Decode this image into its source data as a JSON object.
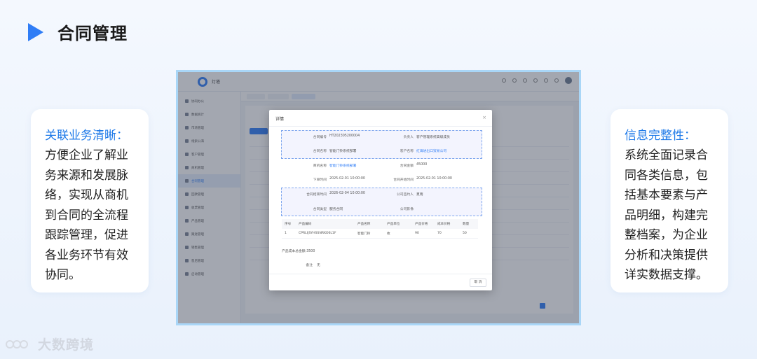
{
  "header": {
    "title": "合同管理"
  },
  "left_card": {
    "title": "关联业务清晰：",
    "lines": [
      "方便企业了解业",
      "务来源和发展脉",
      "络，实现从商机",
      "到合同的全流程",
      "跟踪管理，促进",
      "各业务环节有效",
      "协同。"
    ]
  },
  "right_card": {
    "title": "信息完整性：",
    "lines": [
      "系统全面记录合",
      "同各类信息，包",
      "括基本要素与产",
      "品明细，构建完",
      "整档案，为企业",
      "分析和决策提供",
      "详实数据支撑。"
    ]
  },
  "app": {
    "name": "灯塔",
    "sidebar_items": [
      "协同办公",
      "数据统计",
      "市场管理",
      "线索公海",
      "客户管理",
      "商机管理",
      "合同管理",
      "回款管理",
      "收票管理",
      "产品管理",
      "跟进管理",
      "销售管理",
      "售后管理",
      "启动管理"
    ]
  },
  "modal": {
    "title": "详情",
    "close": "×",
    "fields": {
      "contract_no_label": "合同编号",
      "contract_no": "HT202305200004",
      "owner_label": "负责人",
      "owner": "客户管理系统高级成员",
      "contract_name_label": "合同名称",
      "contract_name": "智能门铃系统部署",
      "customer_label": "客户名称",
      "customer": "红海进出口贸易公司",
      "opportunity_label": "商机名称",
      "opportunity": "智能门铃系统部署",
      "amount_label": "合同金额",
      "amount": "45000",
      "order_time_label": "下单时间",
      "order_time": "2025-02-01 10:00:00",
      "start_time_label": "合同开始时间",
      "start_time": "2025-02-01 10:00:00",
      "end_time_label": "合同结束时间",
      "end_time": "2026-02-04 10:00:00",
      "signer_label": "公司签约人",
      "signer": "夏雨",
      "type_label": "合同类型",
      "type": "服务合同",
      "stamp_label": "公司影像",
      "stamp": ""
    },
    "product_table": {
      "headers": [
        "序号",
        "产品编码",
        "产品名称",
        "产品单位",
        "产品价格",
        "成本价格",
        "数量"
      ],
      "rows": [
        [
          "1",
          "CPRLIJSYHSSNRKO6L1F",
          "智能门铃",
          "枚",
          "90",
          "70",
          "50"
        ]
      ]
    },
    "total_cost": "产品成本总金额:3500",
    "remark_label": "备注",
    "remark": "无",
    "cancel": "取 消"
  },
  "brand": {
    "name": "大数跨境"
  }
}
